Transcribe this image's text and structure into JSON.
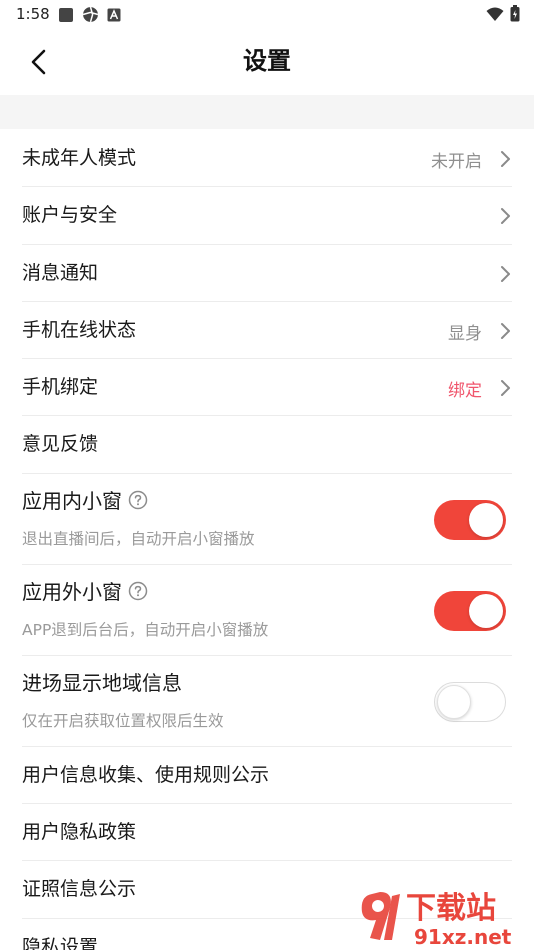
{
  "status_bar": {
    "time": "1:58"
  },
  "nav": {
    "title": "设置"
  },
  "settings": [
    {
      "label": "未成年人模式",
      "value": "未开启"
    },
    {
      "label": "账户与安全"
    },
    {
      "label": "消息通知"
    },
    {
      "label": "手机在线状态",
      "value": "显身"
    },
    {
      "label": "手机绑定",
      "value": "绑定",
      "value_color": "#f0566d"
    },
    {
      "label": "意见反馈"
    },
    {
      "label": "应用内小窗",
      "subtitle": "退出直播间后，自动开启小窗播放",
      "toggle_on": true
    },
    {
      "label": "应用外小窗",
      "subtitle": "APP退到后台后，自动开启小窗播放",
      "toggle_on": true
    },
    {
      "label": "进场显示地域信息",
      "subtitle": "仅在开启获取位置权限后生效",
      "toggle_on": false
    },
    {
      "label": "用户信息收集、使用规则公示"
    },
    {
      "label": "用户隐私政策"
    },
    {
      "label": "证照信息公示"
    },
    {
      "label": "隐私设置"
    }
  ],
  "watermark": {
    "main": "下载站",
    "url": "91xz.net"
  },
  "colors": {
    "accent": "#f0453a",
    "value_accent": "#f0566d",
    "value_gray": "#8f8f8f",
    "subtitle_gray": "#9a9a9a"
  },
  "icons": [
    "back-arrow-icon",
    "chevron-right-icon",
    "help-circle-icon",
    "wifi-icon",
    "battery-icon"
  ]
}
